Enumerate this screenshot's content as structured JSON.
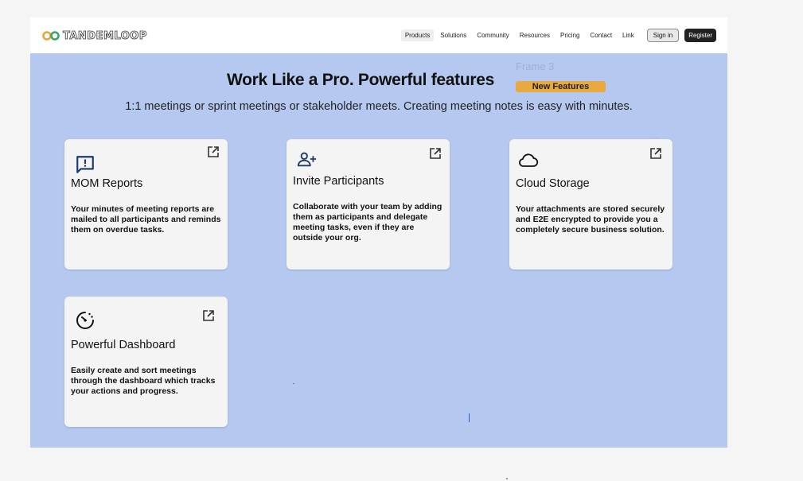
{
  "brand": {
    "name": "TANDEMLOOP"
  },
  "nav": {
    "items": [
      {
        "label": "Products",
        "active": true
      },
      {
        "label": "Solutions"
      },
      {
        "label": "Community"
      },
      {
        "label": "Resources"
      },
      {
        "label": "Pricing"
      },
      {
        "label": "Contact"
      },
      {
        "label": "Link"
      }
    ],
    "signin_label": "Sign in",
    "register_label": "Register"
  },
  "canvas": {
    "frame_label": "Frame 3",
    "badge": "New Features",
    "headline": "Work Like a Pro. Powerful features",
    "subline": "1:1 meetings or sprint meetings or stakeholder meets. Creating meeting notes is easy with minutes.",
    "dots": "..."
  },
  "features": [
    {
      "icon": "message-report-icon",
      "title": "MOM Reports",
      "description": "Your minutes of meeting reports are mailed to all participants and reminds them on overdue tasks."
    },
    {
      "icon": "add-person-icon",
      "title": "Invite Participants",
      "description": "Collaborate with your team by adding them as participants and delegate meeting tasks, even if they are outside your org."
    },
    {
      "icon": "cloud-icon",
      "title": "Cloud Storage",
      "description": "Your attachments are stored securely and E2E encrypted to provide you a completely secure business solution."
    },
    {
      "icon": "dashboard-timer-icon",
      "title": "Powerful Dashboard",
      "description": "Easily create and sort meetings through the dashboard which tracks your actions and progress."
    }
  ],
  "colors": {
    "canvas_background": "#b5c8f0",
    "badge": "#e7a940",
    "card": "#f4f4f4",
    "logo_left": "#e8a33d",
    "logo_right": "#3aa66a"
  }
}
